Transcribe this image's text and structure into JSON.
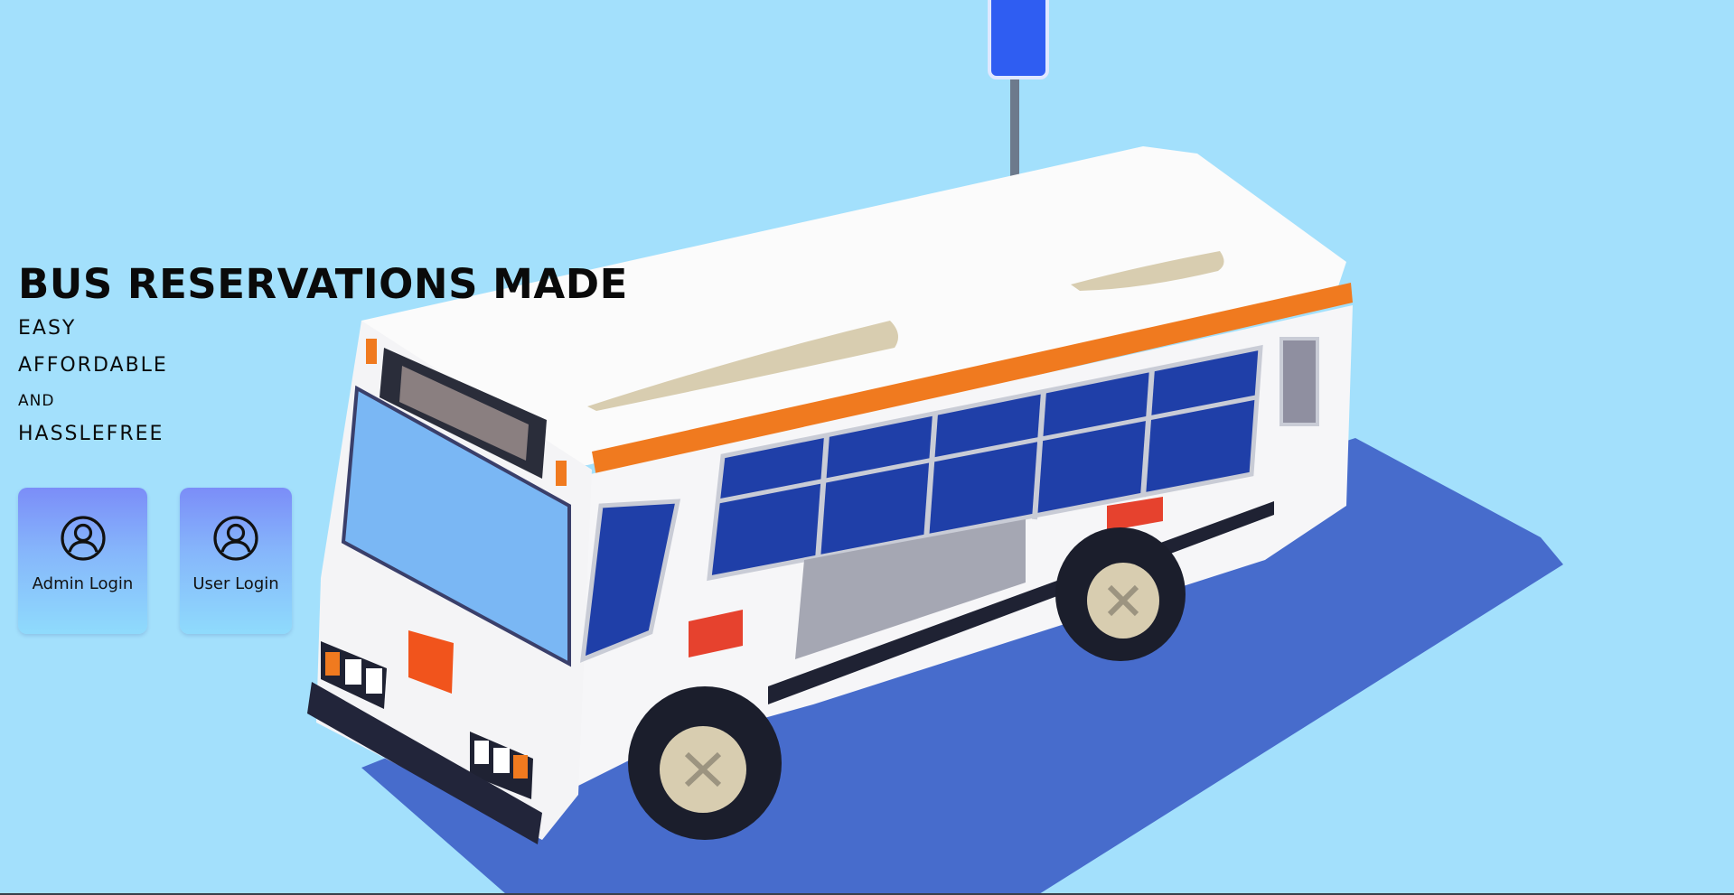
{
  "hero": {
    "headline": "BUS RESERVATIONS MADE",
    "taglines": [
      "EASY",
      "AFFORDABLE",
      "AND",
      "HASSLEFREE"
    ]
  },
  "login_options": [
    {
      "label": "Admin Login",
      "icon": "user-circle-icon"
    },
    {
      "label": "User Login",
      "icon": "user-circle-icon"
    }
  ],
  "colors": {
    "background": "#a3e0fc",
    "card_gradient_top": "#7b8df8",
    "card_gradient_bottom": "#8fdbfc",
    "bus_body": "#ffffff",
    "bus_stripe": "#f07a1f",
    "bus_windows": "#1f3fa8",
    "shadow": "#3e63c9",
    "sign": "#2f5df2"
  }
}
